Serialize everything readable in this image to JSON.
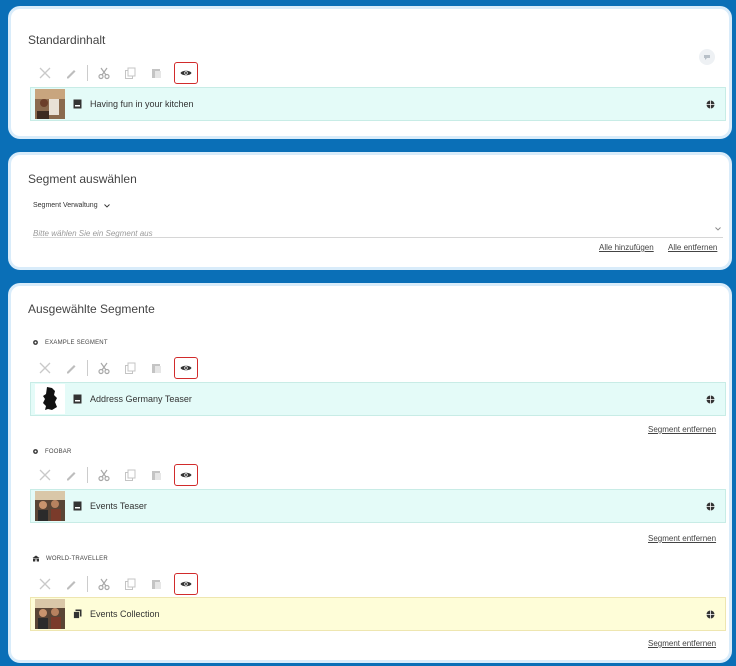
{
  "standard": {
    "title": "Standardinhalt",
    "item": {
      "label": "Having fun in your kitchen"
    }
  },
  "segment_select": {
    "title": "Segment auswählen",
    "dropdown_label": "Segment Verwaltung",
    "placeholder": "Bitte wählen Sie ein Segment aus",
    "add_all": "Alle hinzufügen",
    "remove_all": "Alle entfernen"
  },
  "selected": {
    "title": "Ausgewählte Segmente",
    "remove_label": "Segment entfernen",
    "segments": [
      {
        "name": "EXAMPLE SEGMENT",
        "item": "Address Germany Teaser"
      },
      {
        "name": "FOOBAR",
        "item": "Events Teaser"
      },
      {
        "name": "WORLD-TRAVELLER",
        "item": "Events Collection"
      }
    ]
  },
  "colors": {
    "background": "#0a6fb7",
    "item_cyan": "#e4fbf8",
    "item_yellow": "#fefdd8",
    "highlight": "#d12b2b"
  }
}
